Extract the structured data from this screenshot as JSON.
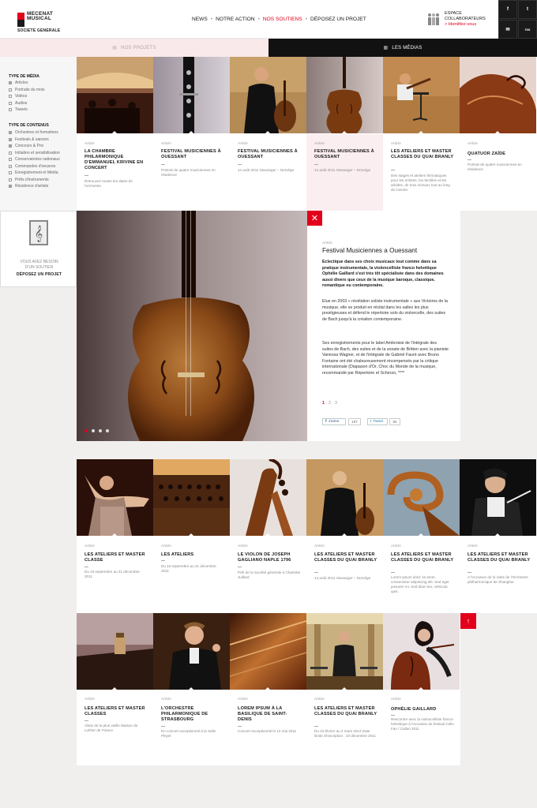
{
  "brand": {
    "line1": "MECENAT",
    "line2": "MUSICAL",
    "sub": "SOCIETE GENERALE"
  },
  "nav": {
    "items": [
      "NEWS",
      "NOTRE ACTION",
      "NOS SOUTIENS",
      "DÉPOSEZ UN PROJET"
    ],
    "active": "NOS SOUTIENS"
  },
  "espace": {
    "line1": "ESPACE",
    "line2": "COLLABORATEURS",
    "link": "> Identifiez-vous"
  },
  "social": [
    "f",
    "t",
    "✉",
    "rss"
  ],
  "tabs": {
    "left": "NOS PROJETS",
    "right": "LES MÉDIAS"
  },
  "filters": {
    "media_heading": "TYPE DE MÉDIA",
    "media": [
      "Articles",
      "Portraits du mois",
      "Vidéos",
      "Audios",
      "Tweets"
    ],
    "content_heading": "TYPE DE CONTENUS",
    "content": [
      "Orchestres et formations",
      "Festivals & saisons",
      "Concours & Prix",
      "Initiation et sensibilisation",
      "Conservatoires nationaux",
      "Commandes d'oeuvres",
      "Enregistrement et Média",
      "Prêts d'instruments",
      "Résidence d'artiste"
    ]
  },
  "besoin": {
    "line1": "VOUS AVEZ BESOIN",
    "line2": "D'UN SOUTIEN",
    "cta": "DÉPOSEZ UN PROJET"
  },
  "row1": [
    {
      "type": "Article",
      "title": "LA CHAMBRE PHILARMONIQUE D'EMMANUEL KRIVINE EN CONCERT",
      "desc": "Retrouvez toutes les dates de l'orchestre"
    },
    {
      "type": "Article",
      "title": "FESTIVAL MUSICIENNES À OUESSANT",
      "desc": "Portrait de quatre musiciennes en résidence"
    },
    {
      "type": "Article",
      "title": "FESTIVAL MUSICIENNES À OUESSANT",
      "desc": "14 août 2011 Stavanger – Norvège"
    },
    {
      "type": "Article",
      "title": "FESTIVAL MUSICIENNES À OUESSANT",
      "desc": "14 août 2011 Stavanger – Norvège"
    },
    {
      "type": "Article",
      "title": "LES ATELIERS ET MASTER CLASSES DU QUAI BRANLY",
      "desc": "Des stages et ateliers thématiques pour les enfants, les familles et les adultes, de tous niveaux tout au long de l'année"
    },
    {
      "type": "Article",
      "title": "QUATUOR ZAÏDE",
      "desc": "Portrait de quatre musiciennes en résidence"
    }
  ],
  "feature": {
    "type": "Article",
    "title": "Festival Musiciennes a Ouessant",
    "lead": "Eclectique dans ses choix musicaux tout comme dans sa pratique instrumentale, la violoncelliste franco helvétique Ophélie Gaillard s'est très tôt spécialisée dans des domaines aussi divers que ceux de la musique baroque, classique, romantique ou contemporaine.",
    "p1": "Elue en 2003 « révélation soliste instrumentale » aux Victoires de la musique, elle se produit en récital dans les salles les plus prestigieuses et défend le répertoire solo du violoncelle, des suites de Bach jusqu'à la création contemporaine.",
    "p2": "Ses enregistrements pour le label Ambroisie de l'intégrale des suites de Bach, des suites et de la sonate de Britten avec la pianiste Vanessa Wagner, et de l'intégrale de Gabriel Fauré avec Bruno Fontaine ont été chaleureusement récompensés par la critique internationale (Diapason d'Or, Choc du Monde de la musique, recommandé par Répertoire et Scherzo, ****",
    "pages": [
      "1",
      "2",
      "3"
    ],
    "current_page": "1",
    "like_label": "J'aime",
    "like_count": "107",
    "tweet_label": "Tweet",
    "tweet_count": "92",
    "slide_count": 4,
    "current_slide": 1
  },
  "row2": [
    {
      "type": "Article",
      "title": "LES ATELIERS ET MASTER CLASSE",
      "desc": "Du 15 septembre au 31 décembre 2011"
    },
    {
      "type": "Article",
      "title": "LES ATELIERS",
      "desc": "Du 15 septembre au 31 décembre 2011"
    },
    {
      "type": "Article",
      "title": "LE VIOLON DE JOSEPH GAGLIANO NAPLE 1796",
      "desc": "Prêt de la Société générale à Charlotte Juillard"
    },
    {
      "type": "Article",
      "title": "LES ATELIERS ET MASTER CLASSES DU QUAI BRANLY",
      "desc": "14 août 2011 Stavanger – Norvège"
    },
    {
      "type": "Article",
      "title": "LES ATELIERS ET MASTER CLASSES DU QUAI BRANLY",
      "desc": "Lorem ipsum dolor sit amet, consectetur adipiscing elit. Sed eget posuere mi. Sed diam leo, vehicula quis."
    },
    {
      "type": "Article",
      "title": "LES ATELIERS ET MASTER CLASSES DU QUAI BRANLY",
      "desc": "A l'occasion de la visite de l'Orchestre philharmonique de Shanghai"
    }
  ],
  "row3": [
    {
      "type": "Article",
      "title": "LES ATELIERS ET MASTER CLASSES",
      "desc": "Visite de la plus vieille Maison de Luthier de France"
    },
    {
      "type": "Article",
      "title": "L'ORCHESTRE PHILARMONIQUE DE STRASBOURG",
      "desc": "En concert exceptionnel à la Salle Pleyel"
    },
    {
      "type": "Article",
      "title": "LOREM IPSUM À LA BASILIQUE DE SAINT-DENIS",
      "desc": "Concert exceptionnel le 12 mai 2011"
    },
    {
      "type": "Article",
      "title": "LES ATELIERS ET MASTER CLASSES DU QUAI BRANLY",
      "desc": "Du 23 février au 4 mars 2012 Date limite d'inscription : 10 décembre 2011"
    },
    {
      "type": "Article",
      "title": "OPHÉLIE GAILLARD",
      "desc": "Rencontre avec la violoncelliste franco-helvétique à l'occasion du festival Cello Fan / Callan 2011"
    }
  ]
}
